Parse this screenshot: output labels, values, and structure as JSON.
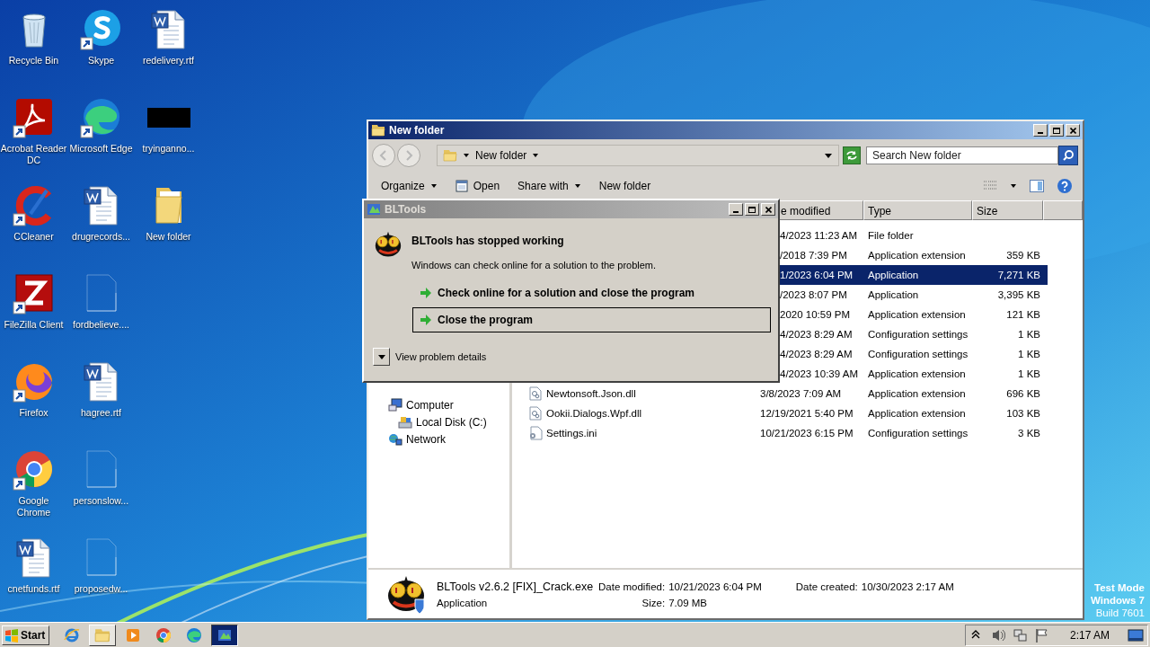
{
  "desktop": {
    "icons": [
      {
        "label": "Recycle Bin",
        "kind": "recycle",
        "shortcut": false
      },
      {
        "label": "Acrobat Reader DC",
        "kind": "acrobat",
        "shortcut": true
      },
      {
        "label": "CCleaner",
        "kind": "ccleaner",
        "shortcut": true
      },
      {
        "label": "FileZilla Client",
        "kind": "filezilla",
        "shortcut": true
      },
      {
        "label": "Firefox",
        "kind": "firefox",
        "shortcut": true
      },
      {
        "label": "Google Chrome",
        "kind": "chrome",
        "shortcut": true
      },
      {
        "label": "cnetfunds.rtf",
        "kind": "word",
        "shortcut": false
      },
      {
        "label": "Skype",
        "kind": "skype",
        "shortcut": true
      },
      {
        "label": "Microsoft Edge",
        "kind": "edge",
        "shortcut": true
      },
      {
        "label": "drugrecords...",
        "kind": "word",
        "shortcut": false
      },
      {
        "label": "fordbelieve....",
        "kind": "blank",
        "shortcut": false
      },
      {
        "label": "hagree.rtf",
        "kind": "word",
        "shortcut": false
      },
      {
        "label": "personslow...",
        "kind": "blank",
        "shortcut": false
      },
      {
        "label": "proposedw...",
        "kind": "blank",
        "shortcut": false
      },
      {
        "label": "redelivery.rtf",
        "kind": "word",
        "shortcut": false
      },
      {
        "label": "tryinganno...",
        "kind": "black",
        "shortcut": false
      },
      {
        "label": "New folder",
        "kind": "folder",
        "shortcut": false
      }
    ],
    "os_notice": [
      "Test Mode",
      "Windows 7",
      "Build 7601"
    ]
  },
  "explorer": {
    "title": "New folder",
    "address": "New folder",
    "search": {
      "placeholder": "Search New folder"
    },
    "toolbar": [
      {
        "label": "Organize",
        "kind": "menu"
      },
      {
        "label": "Open",
        "kind": "open"
      },
      {
        "label": "Share with",
        "kind": "menu"
      },
      {
        "label": "New folder",
        "kind": "plain"
      }
    ],
    "nav": [
      {
        "label": "Computer",
        "kind": "computer",
        "children": [
          {
            "label": "Local Disk (C:)",
            "kind": "disk"
          }
        ]
      },
      {
        "label": "Network",
        "kind": "network"
      }
    ],
    "columns": [
      "e modified",
      "Type",
      "Size"
    ],
    "rows": [
      {
        "date": "4/2023 11:23 AM",
        "type": "File folder",
        "selected": false
      },
      {
        "date": "/2018 7:39 PM",
        "type": "Application extension",
        "size": "359 KB",
        "selected": false
      },
      {
        "date": "1/2023 6:04 PM",
        "type": "Application",
        "size": "7,271 KB",
        "selected": true
      },
      {
        "date": "/2023 8:07 PM",
        "type": "Application",
        "size": "3,395 KB",
        "selected": false
      },
      {
        "date": "2020 10:59 PM",
        "type": "Application extension",
        "size": "121 KB",
        "selected": false
      },
      {
        "date": "4/2023 8:29 AM",
        "type": "Configuration settings",
        "size": "1 KB",
        "selected": false
      },
      {
        "date": "4/2023 8:29 AM",
        "type": "Configuration settings",
        "size": "1 KB",
        "selected": false
      },
      {
        "date": "4/2023 10:39 AM",
        "type": "Application extension",
        "size": "1 KB",
        "selected": false
      },
      {
        "name": "Newtonsoft.Json.dll",
        "kind": "dll",
        "date": "3/8/2023 7:09 AM",
        "type": "Application extension",
        "size": "696 KB",
        "selected": false
      },
      {
        "name": "Ookii.Dialogs.Wpf.dll",
        "kind": "dll",
        "date": "12/19/2021 5:40 PM",
        "type": "Application extension",
        "size": "103 KB",
        "selected": false
      },
      {
        "name": "Settings.ini",
        "kind": "ini",
        "date": "10/21/2023 6:15 PM",
        "type": "Configuration settings",
        "size": "3 KB",
        "selected": false
      }
    ],
    "details": {
      "name": "BLTools v2.6.2 [FIX]_Crack.exe",
      "type": "Application",
      "fields": [
        {
          "label": "Date modified:",
          "value": "10/21/2023 6:04 PM"
        },
        {
          "label": "Date created:",
          "value": "10/30/2023 2:17 AM"
        },
        {
          "label": "Size:",
          "value": "7.09 MB"
        }
      ]
    }
  },
  "dialog": {
    "title": "BLTools",
    "heading": "BLTools has stopped working",
    "message": "Windows can check online for a solution to the problem.",
    "options": [
      {
        "label": "Check online for a solution and close the program",
        "focused": false
      },
      {
        "label": "Close the program",
        "focused": true
      }
    ],
    "details_toggle": "View problem details"
  },
  "taskbar": {
    "start": "Start",
    "apps": [
      {
        "kind": "ie",
        "running": false,
        "focused": false
      },
      {
        "kind": "explorer",
        "running": true,
        "focused": false
      },
      {
        "kind": "media",
        "running": false,
        "focused": false
      },
      {
        "kind": "chrome",
        "running": false,
        "focused": false
      },
      {
        "kind": "edge",
        "running": false,
        "focused": false
      },
      {
        "kind": "bltools",
        "running": true,
        "focused": true
      }
    ],
    "clock": "2:17 AM"
  }
}
